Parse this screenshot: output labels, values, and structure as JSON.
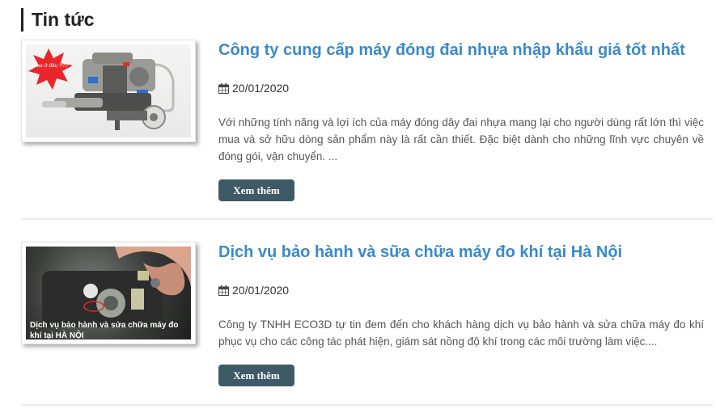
{
  "section": {
    "title": "Tin tức"
  },
  "articles": [
    {
      "title": "Công ty cung cấp máy đóng đai nhựa nhập khẩu giá tốt nhất",
      "date": "20/01/2020",
      "excerpt": "Với những tính năng và lợi ích của máy đóng dây đai nhựa mang lại cho người dùng rất lớn thì việc mua và sở hữu dòng sản phẩm này là rất cần thiết. Đặc biệt dành cho những lĩnh vực chuyên về đóng gói, vận chuyển. ...",
      "button": "Xem thêm",
      "image_badge": "Mua ở đâu ???"
    },
    {
      "title": "Dịch vụ bảo hành và sữa chữa máy đo khí tại Hà Nội",
      "date": "20/01/2020",
      "excerpt": "Công ty TNHH ECO3D tự tin đem đến cho khách hàng dịch vụ bảo hành và sửa chữa máy đo khí phục vụ cho các công tác phát hiện, giám sát nồng độ khí trong các môi trường làm việc....",
      "button": "Xem thêm",
      "image_caption_line1": "Dịch vụ bảo hành và sửa chữa máy đo",
      "image_caption_line2": "khí tại HÀ NỘI"
    }
  ],
  "icons": {
    "date": "calendar-icon"
  },
  "colors": {
    "title": "#3a8ac7",
    "button": "#3d5a66",
    "badge": "#e8262b"
  }
}
